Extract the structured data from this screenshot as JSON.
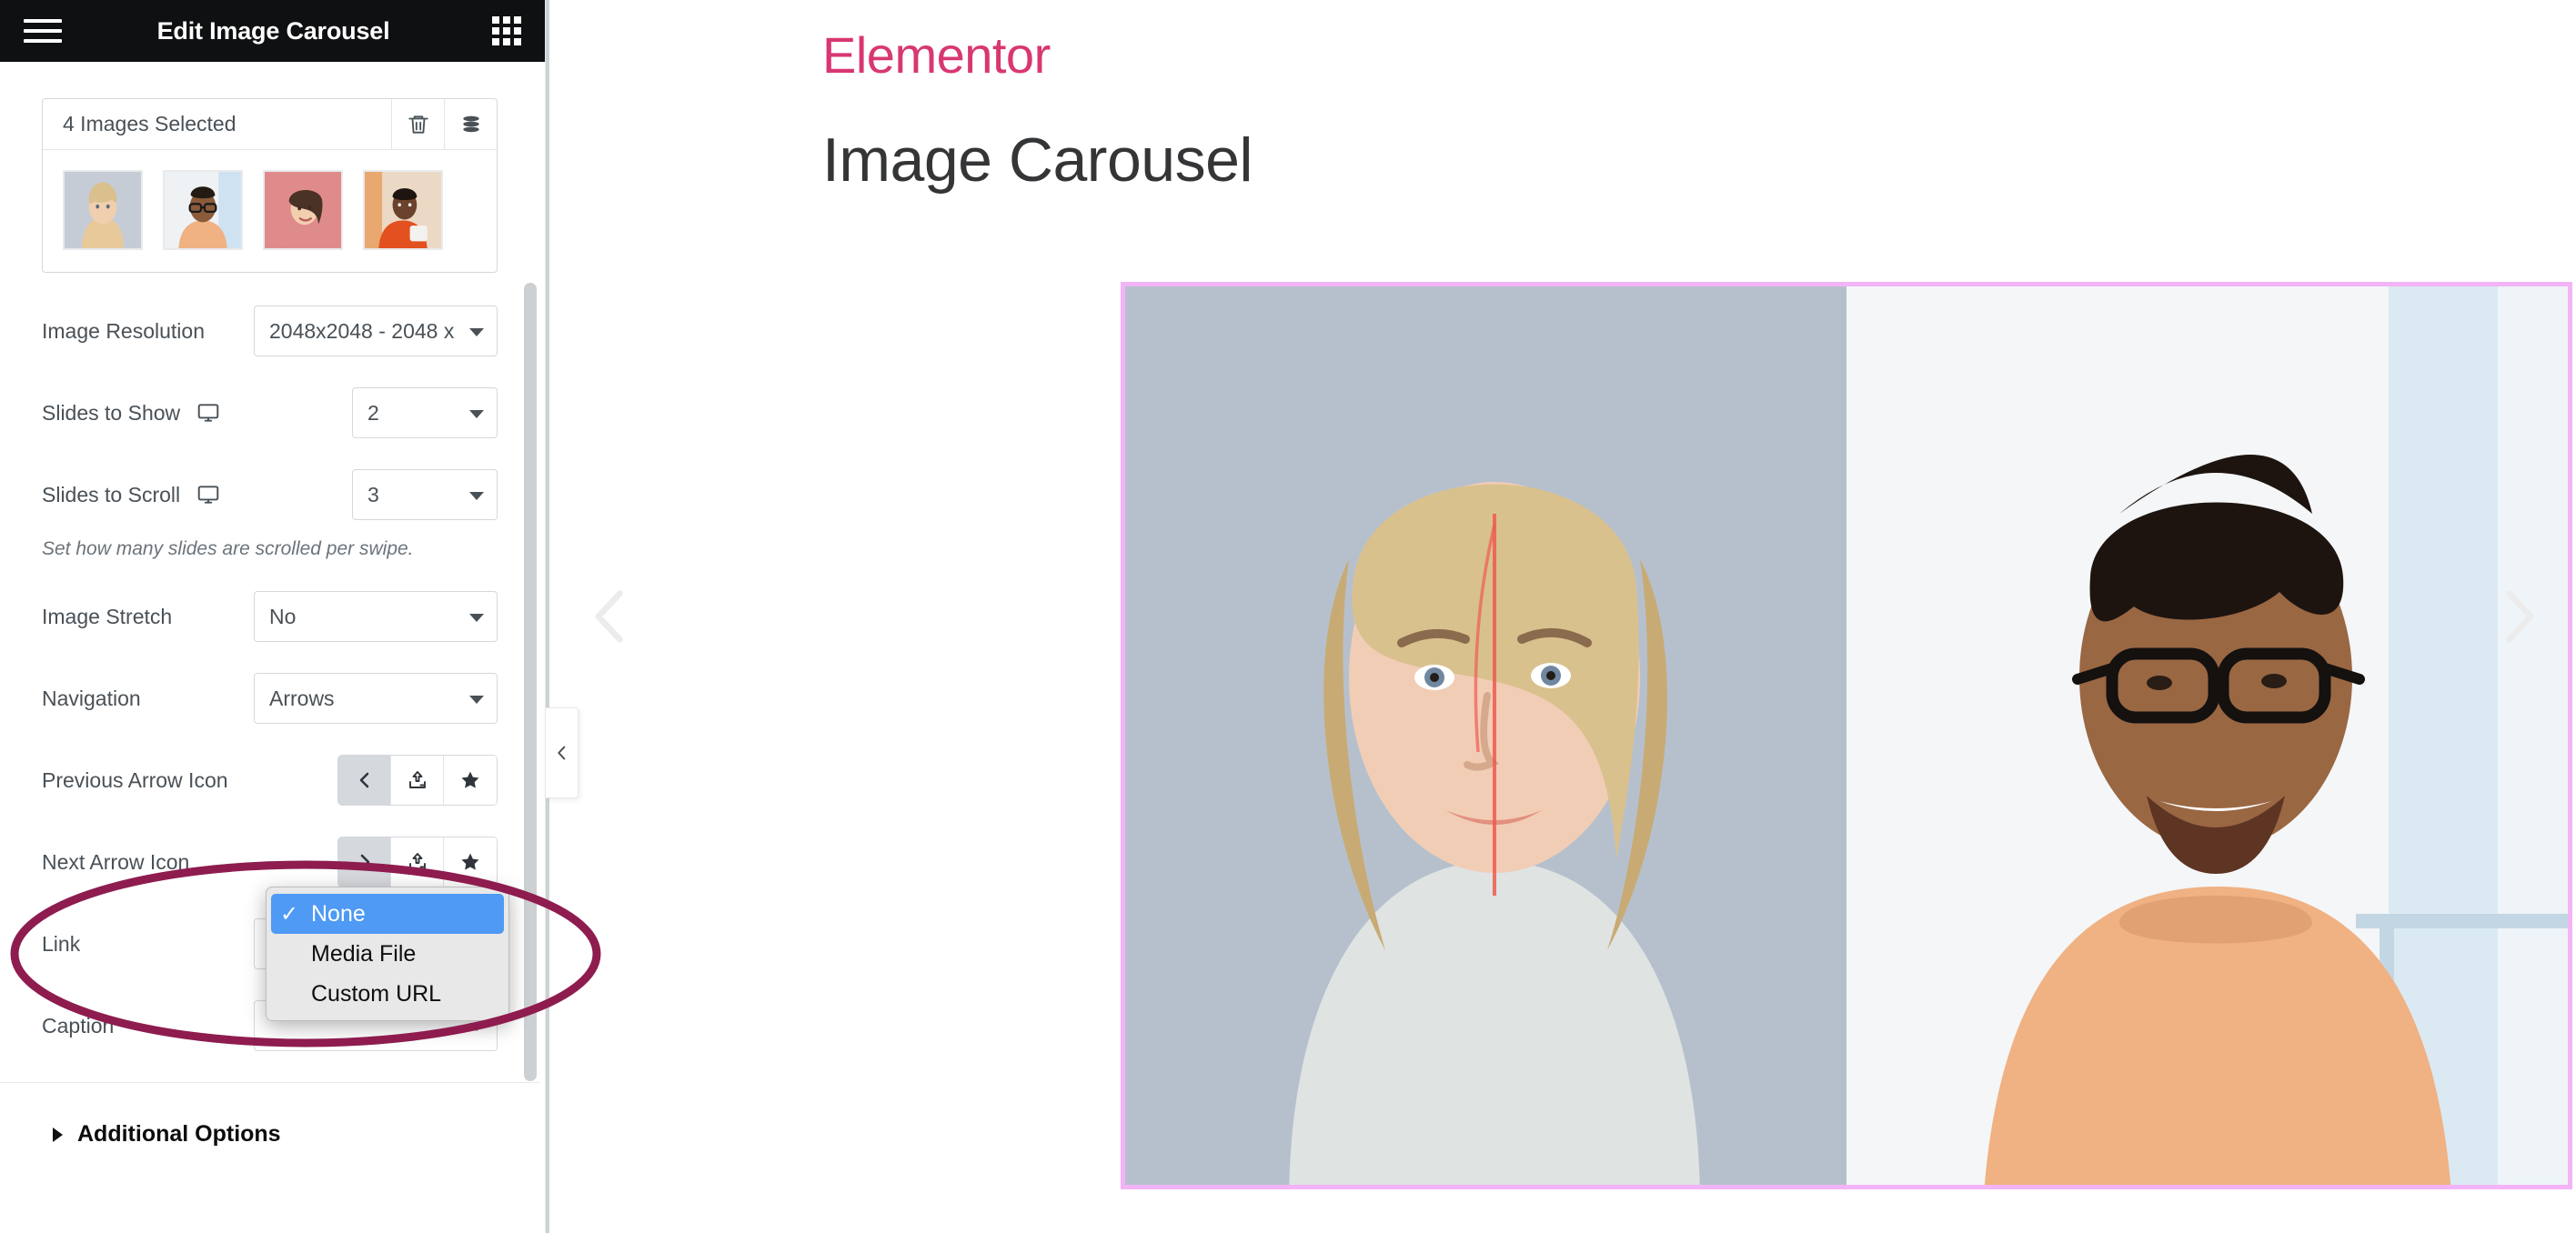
{
  "panel": {
    "title": "Edit Image Carousel",
    "menu_icon": "hamburger-icon",
    "apps_icon": "grid-apps-icon",
    "media": {
      "summary": "4 Images Selected",
      "delete_icon": "trash-icon",
      "gallery_icon": "stack-layers-icon",
      "thumbnails": [
        {
          "alt": "blonde-woman-portrait"
        },
        {
          "alt": "man-with-glasses-portrait"
        },
        {
          "alt": "woman-pink-background-portrait"
        },
        {
          "alt": "woman-holding-mug-portrait"
        }
      ]
    },
    "controls": [
      {
        "label": "Image Resolution",
        "value": "2048x2048 - 2048 x",
        "responsive": false,
        "width": "wide"
      },
      {
        "label": "Slides to Show",
        "value": "2",
        "responsive": true,
        "width": "narrow"
      },
      {
        "label": "Slides to Scroll",
        "value": "3",
        "responsive": true,
        "width": "narrow"
      }
    ],
    "hint": "Set how many slides are scrolled per swipe.",
    "controls2": [
      {
        "label": "Image Stretch",
        "value": "No",
        "width": "wide"
      },
      {
        "label": "Navigation",
        "value": "Arrows",
        "width": "wide"
      }
    ],
    "icon_rows": [
      {
        "label": "Previous Arrow Icon",
        "icons": [
          "chevron-left-icon",
          "upload-icon",
          "star-icon"
        ]
      },
      {
        "label": "Next Arrow Icon",
        "icons": [
          "chevron-right-icon",
          "upload-icon",
          "star-icon"
        ]
      }
    ],
    "link_row_label": "Link",
    "caption_row_label": "Caption",
    "additional_options": "Additional Options",
    "responsive_icon": "desktop-monitor-icon"
  },
  "dropdown": {
    "items": [
      {
        "label": "None",
        "selected": true,
        "check": "✓"
      },
      {
        "label": "Media File",
        "selected": false,
        "check": ""
      },
      {
        "label": "Custom URL",
        "selected": false,
        "check": ""
      }
    ]
  },
  "preview": {
    "brand": "Elementor",
    "heading": "Image Carousel",
    "prev_arrow_icon": "chevron-left-icon",
    "next_arrow_icon": "chevron-right-icon",
    "collapse_icon": "chevron-left-icon",
    "slides": [
      {
        "alt": "blonde-woman-portrait-large"
      },
      {
        "alt": "man-with-glasses-portrait-large"
      }
    ]
  },
  "colors": {
    "brand_pink": "#d83771",
    "section_border": "#f2b4f7",
    "annotation": "#8e1c4f",
    "dropdown_selected": "#4e9af4",
    "panel_header": "#0f1012"
  }
}
